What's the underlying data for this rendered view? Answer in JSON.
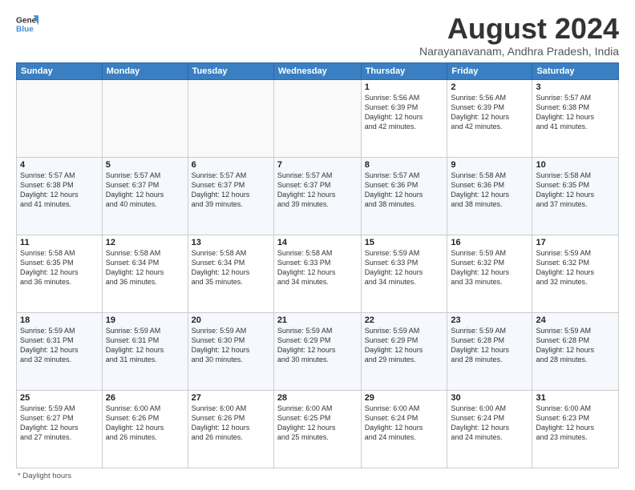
{
  "logo": {
    "line1": "General",
    "line2": "Blue",
    "icon_color": "#4a90d9"
  },
  "title": "August 2024",
  "subtitle": "Narayanavanam, Andhra Pradesh, India",
  "days_of_week": [
    "Sunday",
    "Monday",
    "Tuesday",
    "Wednesday",
    "Thursday",
    "Friday",
    "Saturday"
  ],
  "weeks": [
    [
      {
        "day": "",
        "info": ""
      },
      {
        "day": "",
        "info": ""
      },
      {
        "day": "",
        "info": ""
      },
      {
        "day": "",
        "info": ""
      },
      {
        "day": "1",
        "info": "Sunrise: 5:56 AM\nSunset: 6:39 PM\nDaylight: 12 hours\nand 42 minutes."
      },
      {
        "day": "2",
        "info": "Sunrise: 5:56 AM\nSunset: 6:39 PM\nDaylight: 12 hours\nand 42 minutes."
      },
      {
        "day": "3",
        "info": "Sunrise: 5:57 AM\nSunset: 6:38 PM\nDaylight: 12 hours\nand 41 minutes."
      }
    ],
    [
      {
        "day": "4",
        "info": "Sunrise: 5:57 AM\nSunset: 6:38 PM\nDaylight: 12 hours\nand 41 minutes."
      },
      {
        "day": "5",
        "info": "Sunrise: 5:57 AM\nSunset: 6:37 PM\nDaylight: 12 hours\nand 40 minutes."
      },
      {
        "day": "6",
        "info": "Sunrise: 5:57 AM\nSunset: 6:37 PM\nDaylight: 12 hours\nand 39 minutes."
      },
      {
        "day": "7",
        "info": "Sunrise: 5:57 AM\nSunset: 6:37 PM\nDaylight: 12 hours\nand 39 minutes."
      },
      {
        "day": "8",
        "info": "Sunrise: 5:57 AM\nSunset: 6:36 PM\nDaylight: 12 hours\nand 38 minutes."
      },
      {
        "day": "9",
        "info": "Sunrise: 5:58 AM\nSunset: 6:36 PM\nDaylight: 12 hours\nand 38 minutes."
      },
      {
        "day": "10",
        "info": "Sunrise: 5:58 AM\nSunset: 6:35 PM\nDaylight: 12 hours\nand 37 minutes."
      }
    ],
    [
      {
        "day": "11",
        "info": "Sunrise: 5:58 AM\nSunset: 6:35 PM\nDaylight: 12 hours\nand 36 minutes."
      },
      {
        "day": "12",
        "info": "Sunrise: 5:58 AM\nSunset: 6:34 PM\nDaylight: 12 hours\nand 36 minutes."
      },
      {
        "day": "13",
        "info": "Sunrise: 5:58 AM\nSunset: 6:34 PM\nDaylight: 12 hours\nand 35 minutes."
      },
      {
        "day": "14",
        "info": "Sunrise: 5:58 AM\nSunset: 6:33 PM\nDaylight: 12 hours\nand 34 minutes."
      },
      {
        "day": "15",
        "info": "Sunrise: 5:59 AM\nSunset: 6:33 PM\nDaylight: 12 hours\nand 34 minutes."
      },
      {
        "day": "16",
        "info": "Sunrise: 5:59 AM\nSunset: 6:32 PM\nDaylight: 12 hours\nand 33 minutes."
      },
      {
        "day": "17",
        "info": "Sunrise: 5:59 AM\nSunset: 6:32 PM\nDaylight: 12 hours\nand 32 minutes."
      }
    ],
    [
      {
        "day": "18",
        "info": "Sunrise: 5:59 AM\nSunset: 6:31 PM\nDaylight: 12 hours\nand 32 minutes."
      },
      {
        "day": "19",
        "info": "Sunrise: 5:59 AM\nSunset: 6:31 PM\nDaylight: 12 hours\nand 31 minutes."
      },
      {
        "day": "20",
        "info": "Sunrise: 5:59 AM\nSunset: 6:30 PM\nDaylight: 12 hours\nand 30 minutes."
      },
      {
        "day": "21",
        "info": "Sunrise: 5:59 AM\nSunset: 6:29 PM\nDaylight: 12 hours\nand 30 minutes."
      },
      {
        "day": "22",
        "info": "Sunrise: 5:59 AM\nSunset: 6:29 PM\nDaylight: 12 hours\nand 29 minutes."
      },
      {
        "day": "23",
        "info": "Sunrise: 5:59 AM\nSunset: 6:28 PM\nDaylight: 12 hours\nand 28 minutes."
      },
      {
        "day": "24",
        "info": "Sunrise: 5:59 AM\nSunset: 6:28 PM\nDaylight: 12 hours\nand 28 minutes."
      }
    ],
    [
      {
        "day": "25",
        "info": "Sunrise: 5:59 AM\nSunset: 6:27 PM\nDaylight: 12 hours\nand 27 minutes."
      },
      {
        "day": "26",
        "info": "Sunrise: 6:00 AM\nSunset: 6:26 PM\nDaylight: 12 hours\nand 26 minutes."
      },
      {
        "day": "27",
        "info": "Sunrise: 6:00 AM\nSunset: 6:26 PM\nDaylight: 12 hours\nand 26 minutes."
      },
      {
        "day": "28",
        "info": "Sunrise: 6:00 AM\nSunset: 6:25 PM\nDaylight: 12 hours\nand 25 minutes."
      },
      {
        "day": "29",
        "info": "Sunrise: 6:00 AM\nSunset: 6:24 PM\nDaylight: 12 hours\nand 24 minutes."
      },
      {
        "day": "30",
        "info": "Sunrise: 6:00 AM\nSunset: 6:24 PM\nDaylight: 12 hours\nand 24 minutes."
      },
      {
        "day": "31",
        "info": "Sunrise: 6:00 AM\nSunset: 6:23 PM\nDaylight: 12 hours\nand 23 minutes."
      }
    ]
  ],
  "footer": "* Daylight hours"
}
